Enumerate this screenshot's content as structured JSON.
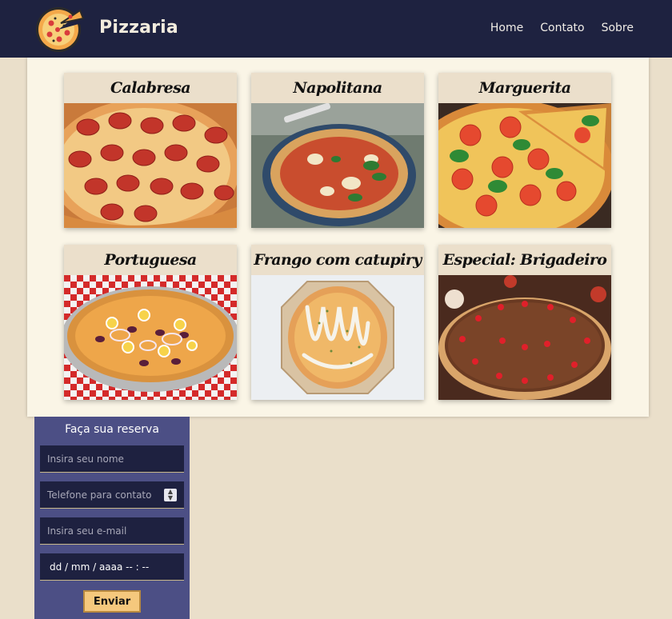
{
  "header": {
    "brand": "Pizzaria",
    "nav": [
      "Home",
      "Contato",
      "Sobre"
    ]
  },
  "menu": {
    "items": [
      {
        "name": "Calabresa"
      },
      {
        "name": "Napolitana"
      },
      {
        "name": "Marguerita"
      },
      {
        "name": "Portuguesa"
      },
      {
        "name": "Frango com catupiry"
      },
      {
        "name": "Especial: Brigadeiro"
      }
    ]
  },
  "reserve": {
    "title": "Faça sua reserva",
    "name_placeholder": "Insira seu nome",
    "phone_placeholder": "Telefone para contato",
    "email_placeholder": "Insira seu e-mail",
    "date_value": "dd / mm / aaaa   -- : --",
    "submit_label": "Enviar"
  },
  "colors": {
    "header_bg": "#1e2240",
    "page_bg": "#eadfca",
    "menu_bg": "#faf5e6",
    "card_title_bg": "#ebdfcb",
    "form_bg": "#4c4f85",
    "field_bg": "#1e2140",
    "button_bg": "#f5c87d"
  }
}
